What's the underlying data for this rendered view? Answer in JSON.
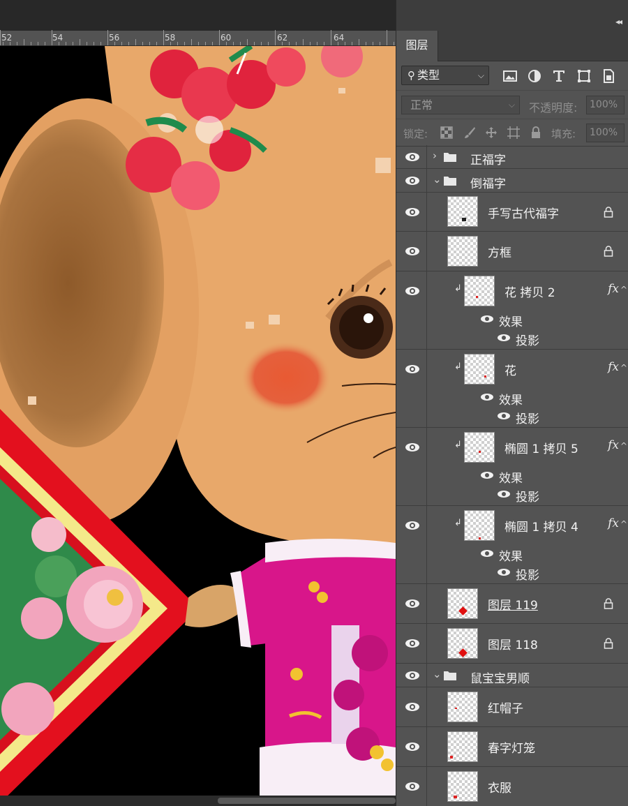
{
  "ruler": {
    "labels": [
      "52",
      "54",
      "56",
      "58",
      "60",
      "62",
      "64"
    ]
  },
  "panel": {
    "tab_label": "图层",
    "collapse_icon": "double-chevron-left-icon",
    "filter": {
      "label": "类型",
      "icon": "search-icon"
    },
    "filter_icons": [
      "image-filter-icon",
      "adjustment-filter-icon",
      "type-filter-icon",
      "shape-filter-icon",
      "smart-object-filter-icon"
    ],
    "blend_mode": "正常",
    "opacity_label": "不透明度:",
    "opacity_value": "100%",
    "lock_label": "锁定:",
    "lock_icons": [
      "lock-transparency-icon",
      "lock-brush-icon",
      "lock-move-icon",
      "lock-artboard-icon",
      "lock-all-icon"
    ],
    "fill_label": "填充:",
    "fill_value": "100%"
  },
  "layers": {
    "group_zhengfu": "正福字",
    "group_daofu": "倒福字",
    "layer_shouxie": "手写古代福字",
    "layer_fangkuang": "方框",
    "layer_hua_copy2": "花 拷贝 2",
    "layer_hua": "花",
    "layer_tuoyuan5": "椭圆 1 拷贝 5",
    "layer_tuoyuan4": "椭圆 1 拷贝 4",
    "layer_119": "图层 119",
    "layer_118": "图层 118",
    "group_shubao": "鼠宝宝男顺",
    "layer_hongmaozi": "红帽子",
    "layer_chunzi": "春字灯笼",
    "layer_yifu": "衣服",
    "effects_label": "效果",
    "shadow_label": "投影",
    "fx_label": "fx"
  },
  "colors": {
    "panel_bg": "#535353",
    "mouse_fur": "#e8a86a",
    "ear_inner": "#a26a35",
    "cheek": "#e5603c",
    "outfit": "#d8168a",
    "fu_red": "#e3101e",
    "fu_border": "#f4e98a"
  }
}
